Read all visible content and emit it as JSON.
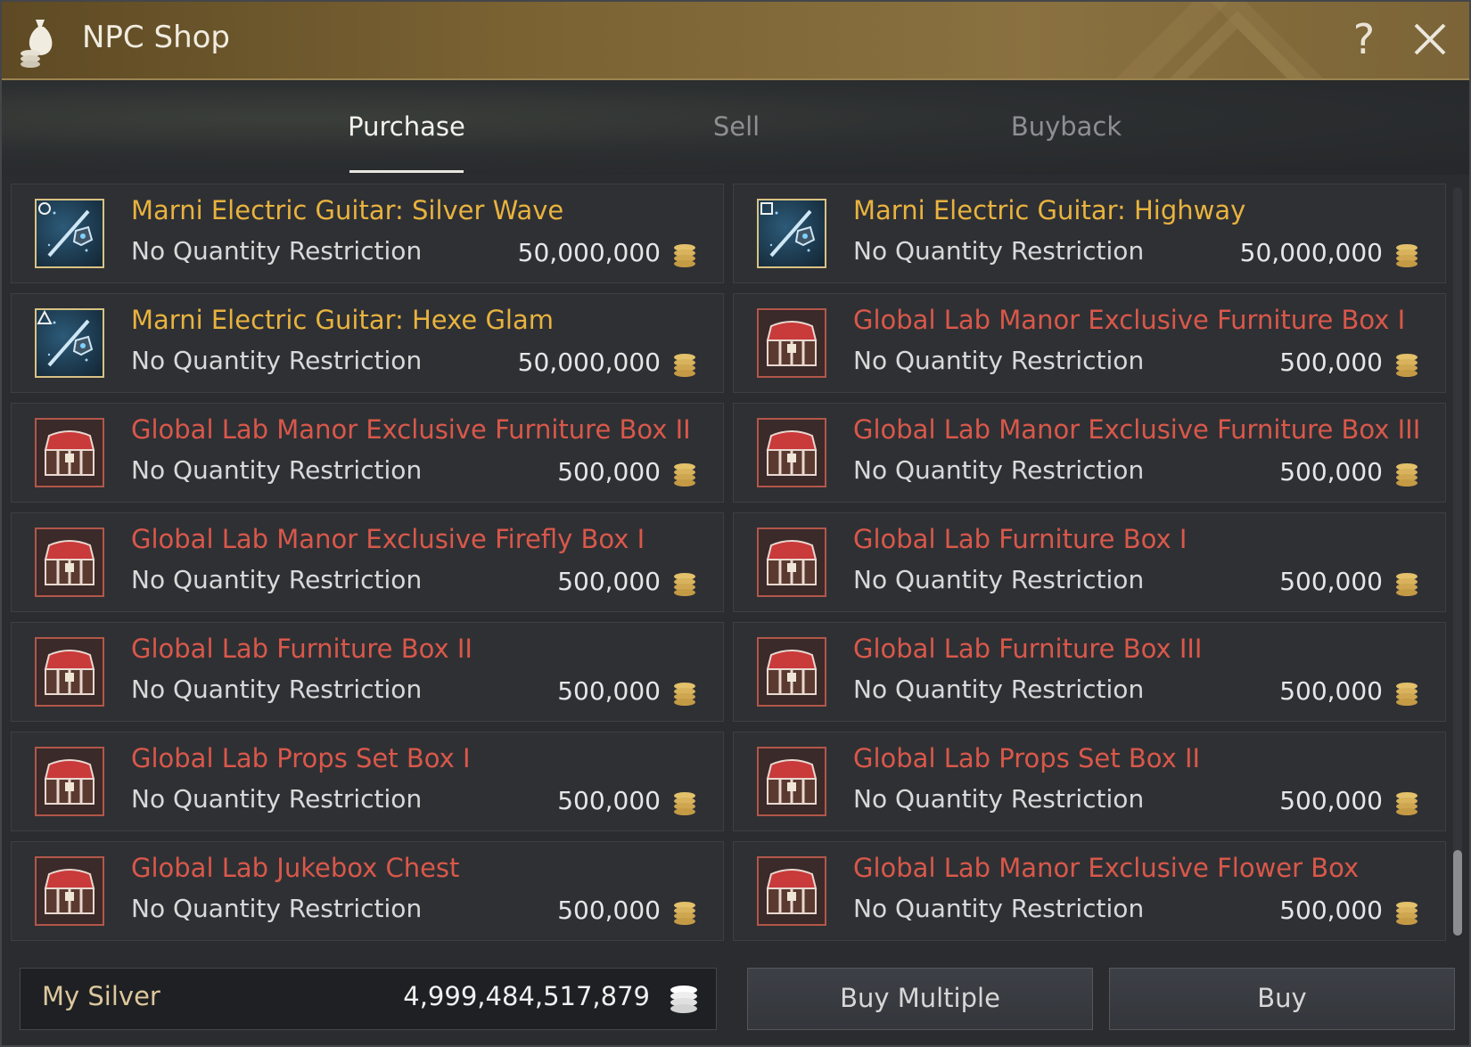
{
  "window": {
    "title": "NPC Shop",
    "help_label": "?"
  },
  "tabs": [
    {
      "label": "Purchase",
      "active": true
    },
    {
      "label": "Sell",
      "active": false
    },
    {
      "label": "Buyback",
      "active": false
    }
  ],
  "items": [
    {
      "name": "Marni Electric Guitar: Silver Wave",
      "restriction": "No Quantity Restriction",
      "price": "50,000,000",
      "icon": "guitar-icon",
      "grade": "circle",
      "color": "#e8b33e"
    },
    {
      "name": "Marni Electric Guitar: Highway",
      "restriction": "No Quantity Restriction",
      "price": "50,000,000",
      "icon": "guitar-icon",
      "grade": "square",
      "color": "#e8b33e"
    },
    {
      "name": "Marni Electric Guitar: Hexe Glam",
      "restriction": "No Quantity Restriction",
      "price": "50,000,000",
      "icon": "guitar-icon",
      "grade": "triangle",
      "color": "#e8b33e"
    },
    {
      "name": "Global Lab Manor Exclusive Furniture Box I",
      "restriction": "No Quantity Restriction",
      "price": "500,000",
      "icon": "chest-icon",
      "color": "#d9584a"
    },
    {
      "name": "Global Lab Manor Exclusive Furniture Box II",
      "restriction": "No Quantity Restriction",
      "price": "500,000",
      "icon": "chest-icon",
      "color": "#d9584a"
    },
    {
      "name": "Global Lab Manor Exclusive Furniture Box III",
      "restriction": "No Quantity Restriction",
      "price": "500,000",
      "icon": "chest-icon",
      "color": "#d9584a"
    },
    {
      "name": "Global Lab Manor Exclusive Firefly Box I",
      "restriction": "No Quantity Restriction",
      "price": "500,000",
      "icon": "chest-icon",
      "color": "#d9584a"
    },
    {
      "name": "Global Lab Furniture Box I",
      "restriction": "No Quantity Restriction",
      "price": "500,000",
      "icon": "chest-icon",
      "color": "#d9584a"
    },
    {
      "name": "Global Lab Furniture Box II",
      "restriction": "No Quantity Restriction",
      "price": "500,000",
      "icon": "chest-icon",
      "color": "#d9584a"
    },
    {
      "name": "Global Lab Furniture Box III",
      "restriction": "No Quantity Restriction",
      "price": "500,000",
      "icon": "chest-icon",
      "color": "#d9584a"
    },
    {
      "name": "Global Lab Props Set Box I",
      "restriction": "No Quantity Restriction",
      "price": "500,000",
      "icon": "chest-icon",
      "color": "#d9584a"
    },
    {
      "name": "Global Lab Props Set Box II",
      "restriction": "No Quantity Restriction",
      "price": "500,000",
      "icon": "chest-icon",
      "color": "#d9584a"
    },
    {
      "name": "Global Lab Jukebox Chest",
      "restriction": "No Quantity Restriction",
      "price": "500,000",
      "icon": "chest-icon",
      "color": "#d9584a"
    },
    {
      "name": "Global Lab Manor Exclusive Flower Box",
      "restriction": "No Quantity Restriction",
      "price": "500,000",
      "icon": "chest-icon",
      "color": "#d9584a"
    }
  ],
  "footer": {
    "silver_label": "My Silver",
    "silver_value": "4,999,484,517,879",
    "buy_multiple_label": "Buy Multiple",
    "buy_label": "Buy"
  },
  "colors": {
    "title_bar": "#7a6233",
    "name_gold": "#e8b33e",
    "name_red": "#d9584a",
    "coin": "#d8b25c"
  }
}
